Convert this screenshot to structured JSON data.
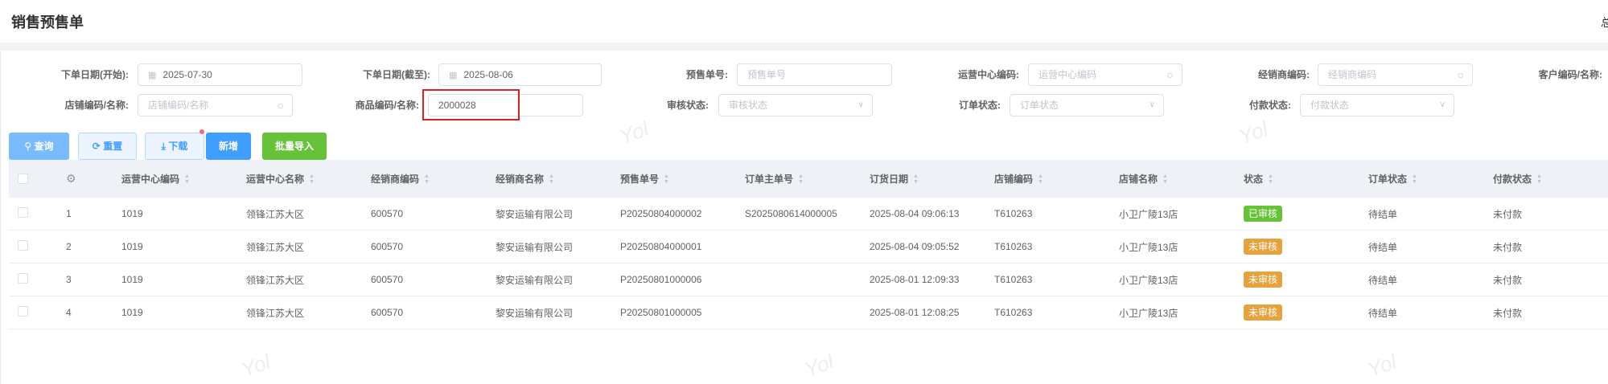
{
  "page": {
    "title": "销售预售单",
    "topright_text": "总"
  },
  "watermark": "Yol",
  "filters": {
    "order_date_start": {
      "label": "下单日期(开始):",
      "value": "2025-07-30"
    },
    "order_date_end": {
      "label": "下单日期(截至):",
      "value": "2025-08-06"
    },
    "presale_no": {
      "label": "预售单号:",
      "placeholder": "预售单号"
    },
    "ops_center_code": {
      "label": "运营中心编码:",
      "placeholder": "运营中心编码"
    },
    "dealer_code": {
      "label": "经销商编码:",
      "placeholder": "经销商编码"
    },
    "customer_code": {
      "label": "客户编码/名称:"
    },
    "store_code": {
      "label": "店铺编码/名称:",
      "placeholder": "店铺编码/名称"
    },
    "product_code": {
      "label": "商品编码/名称:",
      "value": "2000028"
    },
    "audit_status": {
      "label": "审核状态:",
      "placeholder": "审核状态"
    },
    "order_status": {
      "label": "订单状态:",
      "placeholder": "订单状态"
    },
    "payment_status": {
      "label": "付款状态:",
      "placeholder": "付款状态"
    }
  },
  "toolbar": {
    "query": "查询",
    "reset": "重置",
    "download": "下载",
    "add": "新增",
    "batch_import": "批量导入"
  },
  "table": {
    "headers": [
      "运营中心编码",
      "运营中心名称",
      "经销商编码",
      "经销商名称",
      "预售单号",
      "订单主单号",
      "订货日期",
      "店铺编码",
      "店铺名称",
      "状态",
      "订单状态",
      "付款状态"
    ],
    "rows": [
      {
        "idx": "1",
        "cells": [
          "1019",
          "领锋江苏大区",
          "600570",
          "黎安运输有限公司",
          "P20250804000002",
          "S2025080614000005",
          "2025-08-04 09:06:13",
          "T610263",
          "小卫广陵13店",
          "已审核",
          "待结单",
          "未付款"
        ],
        "status_color": "#67c23a"
      },
      {
        "idx": "2",
        "cells": [
          "1019",
          "领锋江苏大区",
          "600570",
          "黎安运输有限公司",
          "P20250804000001",
          "",
          "2025-08-04 09:05:52",
          "T610263",
          "小卫广陵13店",
          "未审核",
          "待结单",
          "未付款"
        ],
        "status_color": "#e6a23c"
      },
      {
        "idx": "3",
        "cells": [
          "1019",
          "领锋江苏大区",
          "600570",
          "黎安运输有限公司",
          "P20250801000006",
          "",
          "2025-08-01 12:09:33",
          "T610263",
          "小卫广陵13店",
          "未审核",
          "待结单",
          "未付款"
        ],
        "status_color": "#e6a23c"
      },
      {
        "idx": "4",
        "cells": [
          "1019",
          "领锋江苏大区",
          "600570",
          "黎安运输有限公司",
          "P20250801000005",
          "",
          "2025-08-01 12:08:25",
          "T610263",
          "小卫广陵13店",
          "未审核",
          "待结单",
          "未付款"
        ],
        "status_color": "#e6a23c"
      }
    ]
  }
}
